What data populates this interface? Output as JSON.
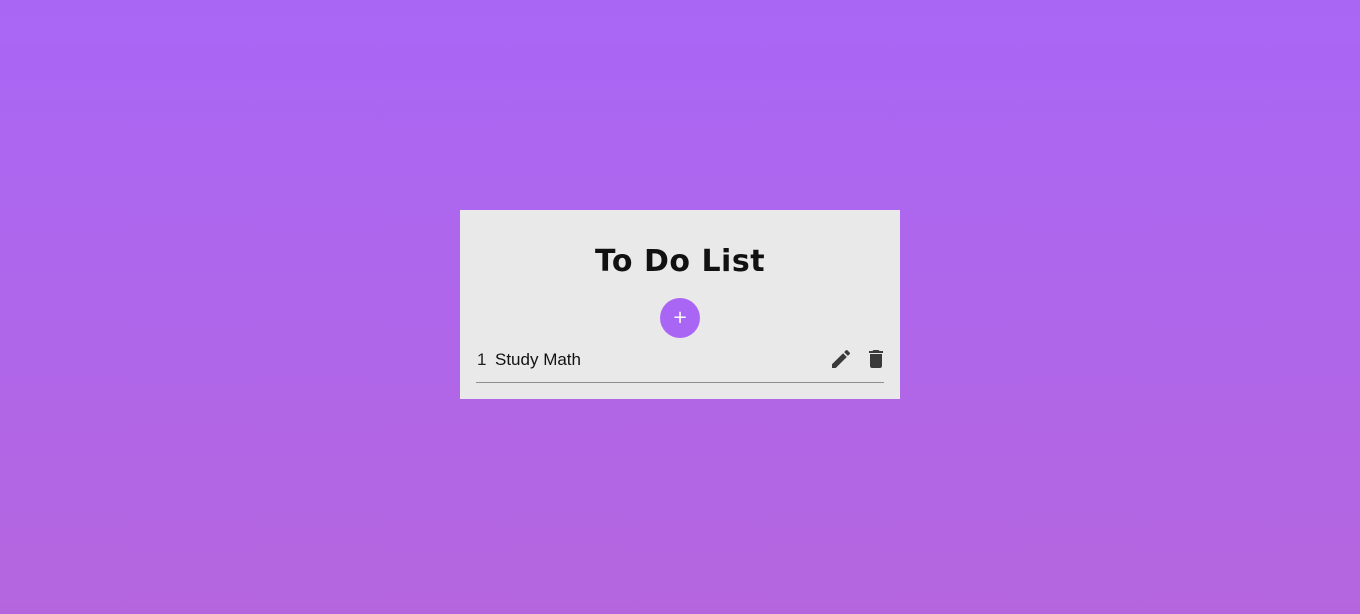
{
  "app": {
    "title": "To Do List",
    "accent_color": "#a966f5",
    "icon_color": "#3a3a3a"
  },
  "add_button": {
    "label": "+",
    "icon": "plus-icon"
  },
  "todos": [
    {
      "number": "1",
      "text": "Study Math",
      "edit_icon": "pencil-icon",
      "delete_icon": "trash-icon"
    }
  ]
}
